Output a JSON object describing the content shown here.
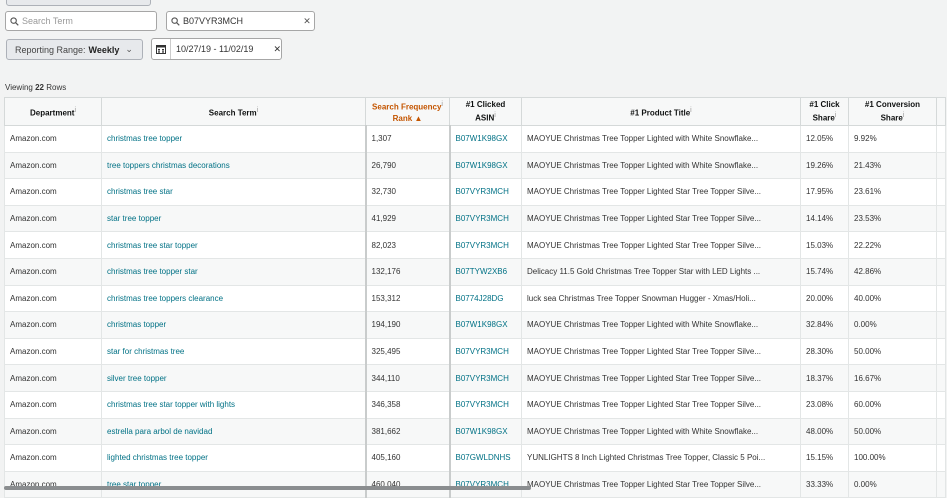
{
  "search": {
    "term_placeholder": "Search Term",
    "asin_value": "B07VYR3MCH"
  },
  "reporting": {
    "label": "Reporting Range:",
    "value": "Weekly",
    "date_range": "10/27/19 - 11/02/19"
  },
  "viewing": {
    "prefix": "Viewing",
    "count": "22",
    "suffix": "Rows"
  },
  "columns": {
    "department": "Department",
    "search_term": "Search Term",
    "rank_line1": "Search Frequency",
    "rank_line2": "Rank",
    "asin_line1": "#1 Clicked",
    "asin_line2": "ASIN",
    "title": "#1 Product Title",
    "click_line1": "#1 Click",
    "click_line2": "Share",
    "conv_line1": "#1 Conversion",
    "conv_line2": "Share"
  },
  "rows": [
    {
      "dept": "Amazon.com",
      "term": "christmas tree topper",
      "rank": "1,307",
      "asin": "B07W1K98GX",
      "title": "MAOYUE Christmas Tree Topper Lighted with White Snowflake...",
      "click": "12.05%",
      "conv": "9.92%"
    },
    {
      "dept": "Amazon.com",
      "term": "tree toppers christmas decorations",
      "rank": "26,790",
      "asin": "B07W1K98GX",
      "title": "MAOYUE Christmas Tree Topper Lighted with White Snowflake...",
      "click": "19.26%",
      "conv": "21.43%"
    },
    {
      "dept": "Amazon.com",
      "term": "christmas tree star",
      "rank": "32,730",
      "asin": "B07VYR3MCH",
      "title": "MAOYUE Christmas Tree Topper Lighted Star Tree Topper Silve...",
      "click": "17.95%",
      "conv": "23.61%"
    },
    {
      "dept": "Amazon.com",
      "term": "star tree topper",
      "rank": "41,929",
      "asin": "B07VYR3MCH",
      "title": "MAOYUE Christmas Tree Topper Lighted Star Tree Topper Silve...",
      "click": "14.14%",
      "conv": "23.53%"
    },
    {
      "dept": "Amazon.com",
      "term": "christmas tree star topper",
      "rank": "82,023",
      "asin": "B07VYR3MCH",
      "title": "MAOYUE Christmas Tree Topper Lighted Star Tree Topper Silve...",
      "click": "15.03%",
      "conv": "22.22%"
    },
    {
      "dept": "Amazon.com",
      "term": "christmas tree topper star",
      "rank": "132,176",
      "asin": "B07TYW2XB6",
      "title": "Delicacy 11.5 Gold Christmas Tree Topper Star with LED Lights ...",
      "click": "15.74%",
      "conv": "42.86%"
    },
    {
      "dept": "Amazon.com",
      "term": "christmas tree toppers clearance",
      "rank": "153,312",
      "asin": "B0774J28DG",
      "title": "luck sea Christmas Tree Topper Snowman Hugger - Xmas/Holi...",
      "click": "20.00%",
      "conv": "40.00%"
    },
    {
      "dept": "Amazon.com",
      "term": "christmas topper",
      "rank": "194,190",
      "asin": "B07W1K98GX",
      "title": "MAOYUE Christmas Tree Topper Lighted with White Snowflake...",
      "click": "32.84%",
      "conv": "0.00%"
    },
    {
      "dept": "Amazon.com",
      "term": "star for christmas tree",
      "rank": "325,495",
      "asin": "B07VYR3MCH",
      "title": "MAOYUE Christmas Tree Topper Lighted Star Tree Topper Silve...",
      "click": "28.30%",
      "conv": "50.00%"
    },
    {
      "dept": "Amazon.com",
      "term": "silver tree topper",
      "rank": "344,110",
      "asin": "B07VYR3MCH",
      "title": "MAOYUE Christmas Tree Topper Lighted Star Tree Topper Silve...",
      "click": "18.37%",
      "conv": "16.67%"
    },
    {
      "dept": "Amazon.com",
      "term": "christmas tree star topper with lights",
      "rank": "346,358",
      "asin": "B07VYR3MCH",
      "title": "MAOYUE Christmas Tree Topper Lighted Star Tree Topper Silve...",
      "click": "23.08%",
      "conv": "60.00%"
    },
    {
      "dept": "Amazon.com",
      "term": "estrella para arbol de navidad",
      "rank": "381,662",
      "asin": "B07W1K98GX",
      "title": "MAOYUE Christmas Tree Topper Lighted with White Snowflake...",
      "click": "48.00%",
      "conv": "50.00%"
    },
    {
      "dept": "Amazon.com",
      "term": "lighted christmas tree topper",
      "rank": "405,160",
      "asin": "B07GWLDNHS",
      "title": "YUNLIGHTS 8 Inch Lighted Christmas Tree Topper, Classic 5 Poi...",
      "click": "15.15%",
      "conv": "100.00%"
    },
    {
      "dept": "Amazon.com",
      "term": "tree star topper",
      "rank": "460,040",
      "asin": "B07VYR3MCH",
      "title": "MAOYUE Christmas Tree Topper Lighted Star Tree Topper Silve...",
      "click": "33.33%",
      "conv": "0.00%"
    }
  ]
}
